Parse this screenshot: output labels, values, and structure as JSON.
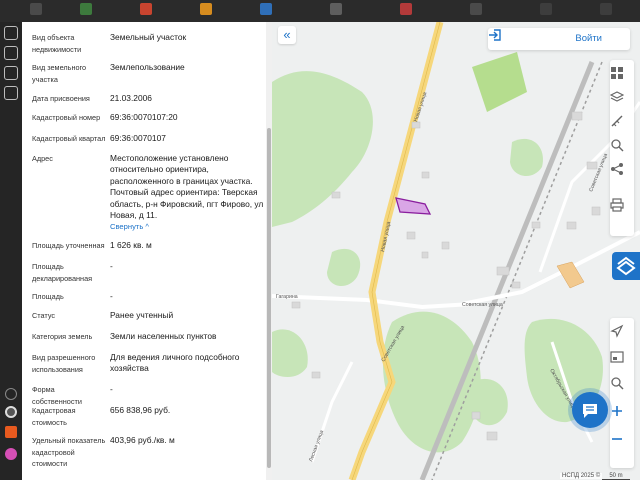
{
  "panel": {
    "rows": [
      {
        "label": "Вид объекта недвижимости",
        "value": "Земельный участок"
      },
      {
        "label": "Вид земельного участка",
        "value": "Землепользование"
      },
      {
        "label": "Дата присвоения",
        "value": "21.03.2006"
      },
      {
        "label": "Кадастровый номер",
        "value": "69:36:0070107:20"
      },
      {
        "label": "Кадастровый квартал",
        "value": "69:36:0070107"
      },
      {
        "label": "Адрес",
        "value": "Местоположение установлено относительно ориентира, расположенного в границах участка. Почтовый адрес ориентира: Тверская область, р-н Фировский, пгт Фирово, ул Новая, д 11."
      },
      {
        "label": "Площадь уточненная",
        "value": "1 626 кв. м"
      },
      {
        "label": "Площадь декларированная",
        "value": "-"
      },
      {
        "label": "Площадь",
        "value": "-"
      },
      {
        "label": "Статус",
        "value": "Ранее учтенный"
      },
      {
        "label": "Категория земель",
        "value": "Земли населенных пунктов"
      },
      {
        "label": "Вид разрешенного использования",
        "value": "Для ведения личного подсобного хозяйства"
      },
      {
        "label": "Форма собственности",
        "value": "-"
      },
      {
        "label": "Кадастровая стоимость",
        "value": "656 838,96 руб."
      },
      {
        "label": "Удельный показатель кадастровой стоимости",
        "value": "403,96 руб./кв. м"
      }
    ],
    "collapse_link": "Свернуть ^"
  },
  "map": {
    "login_label": "Войти",
    "copyright": "НСПД 2025 ©",
    "scale_label": "50 m",
    "streets": {
      "novaya": "Новая улица",
      "gagarin": "Гагарина",
      "sovetskaya": "Советская улица",
      "sovetskaya2": "Советская улица",
      "sovetskaya3": "Советская улица",
      "lesnaya": "Лесная улица",
      "oktyabrskaya": "Октябрьская улица"
    }
  },
  "colors": {
    "accent": "#1e73c8",
    "parcel_fill": "#d9a6e6",
    "parcel_stroke": "#8a1f9e",
    "forest": "#c7e5b8",
    "road": "#f6d77b"
  }
}
